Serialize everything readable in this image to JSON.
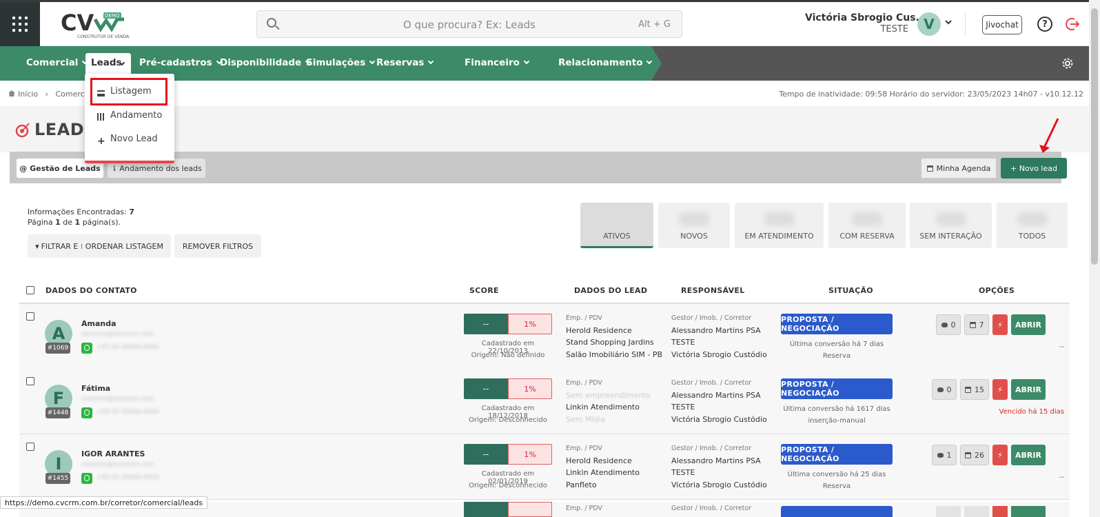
{
  "header": {
    "search_placeholder": "O que procura? Ex: Leads",
    "search_shortcut": "Alt + G",
    "user_name": "Victória Sbrogio Cus...",
    "user_role": "TESTE",
    "avatar_letter": "V",
    "jivochat_label": "Jivochat",
    "help_label": "?"
  },
  "nav": {
    "items": [
      "Comercial",
      "Leads",
      "Pré-cadastros",
      "Disponibilidade",
      "Simulações",
      "Reservas",
      "Financeiro",
      "Relacionamento"
    ]
  },
  "dropdown": {
    "items": [
      "Listagem",
      "Andamento",
      "Novo Lead"
    ]
  },
  "breadcrumb": {
    "home": "Início",
    "current": "Comercia"
  },
  "server_info": "Tempo de inatividade: 09:58  Horário do servidor: 23/05/2023 14h07 - v10.12.12",
  "page_title": "LEADS",
  "tabs": {
    "gestao": "@ Gestão de Leads",
    "andamento": "Andamento dos leads"
  },
  "actions": {
    "agenda": "Minha Agenda",
    "novo_lead": "+ Novo lead"
  },
  "info": {
    "line1_label": "Informações Encontradas: ",
    "line1_value": "7",
    "line2_pre": "Página ",
    "line2_page": "1",
    "line2_mid": " de ",
    "line2_total": "1",
    "line2_post": " página(s)."
  },
  "filters": {
    "filtrar": "FILTRAR E ⁝ ORDENAR LISTAGEM",
    "remover": "REMOVER FILTROS"
  },
  "categories": [
    "ATIVOS",
    "NOVOS",
    "EM ATENDIMENTO",
    "COM RESERVA",
    "SEM INTERAÇÃO",
    "TODOS"
  ],
  "table": {
    "headers": [
      "DADOS DO CONTATO",
      "SCORE",
      "DADOS DO LEAD",
      "RESPONSÁVEL",
      "SITUAÇÃO",
      "OPÇÕES"
    ],
    "rows": [
      {
        "letter": "A",
        "id": "#1069",
        "name": "Amanda",
        "score_left": "--",
        "score_pct": "1%",
        "cadastro": "Cadastrado em 22/10/2013",
        "origem": "Origem: Não definido",
        "lead_label": "Emp. / PDV",
        "lead1": "Herold Residence",
        "lead2": "Stand Shopping Jardins",
        "lead3": "Salão Imobiliário SIM - PB",
        "resp_label": "Gestor / Imob. / Corretor",
        "resp1": "Alessandro Martins PSA",
        "resp2": "TESTE",
        "resp3": "Victória Sbrogio Custódio",
        "situacao": "PROPOSTA / NEGOCIAÇÃO",
        "sit1": "Última conversão há 7 dias",
        "sit2": "Reserva",
        "msgs": "0",
        "cal": "7",
        "abrir": "ABRIR",
        "note": "--"
      },
      {
        "letter": "F",
        "id": "#1448",
        "name": "Fátima",
        "score_left": "--",
        "score_pct": "1%",
        "cadastro": "Cadastrado em 18/12/2018",
        "origem": "Origem: Desconhecido",
        "lead_label": "Emp. / PDV",
        "lead1": "Sem empreendimento",
        "lead2": "Linkin Atendimento",
        "lead3": "Sem Mídia",
        "resp_label": "Gestor / Imob. / Corretor",
        "resp1": "Alessandro Martins PSA",
        "resp2": "TESTE",
        "resp3": "Victória Sbrogio Custódio",
        "situacao": "PROPOSTA / NEGOCIAÇÃO",
        "sit1": "Última conversão há 1617 dias",
        "sit2": "inserção-manual",
        "msgs": "0",
        "cal": "15",
        "abrir": "ABRIR",
        "note": "Vencido há 15 dias"
      },
      {
        "letter": "I",
        "id": "#1455",
        "name": "IGOR ARANTES",
        "score_left": "--",
        "score_pct": "1%",
        "cadastro": "Cadastrado em 02/01/2019",
        "origem": "Origem: Desconhecido",
        "lead_label": "Emp. / PDV",
        "lead1": "Herold Residence",
        "lead2": "Linkin Atendimento",
        "lead3": "Panfleto",
        "resp_label": "Gestor / Imob. / Corretor",
        "resp1": "Alessandro Martins PSA",
        "resp2": "TESTE",
        "resp3": "Victória Sbrogio Custódio",
        "situacao": "PROPOSTA / NEGOCIAÇÃO",
        "sit1": "Última conversão há 25 dias",
        "sit2": "Reserva",
        "msgs": "1",
        "cal": "26",
        "abrir": "ABRIR",
        "note": "--"
      }
    ],
    "row4_label": "Emp. / PDV",
    "row4_resp": "Gestor / Imob. / Corretor"
  },
  "status_url": "https://demo.cvcrm.com.br/corretor/comercial/leads",
  "colors": {
    "nav_green": "#3c8a67",
    "accent_green": "#2d7a5f",
    "situacao_blue": "#2a5acb",
    "highlight_red": "#e5101a"
  }
}
